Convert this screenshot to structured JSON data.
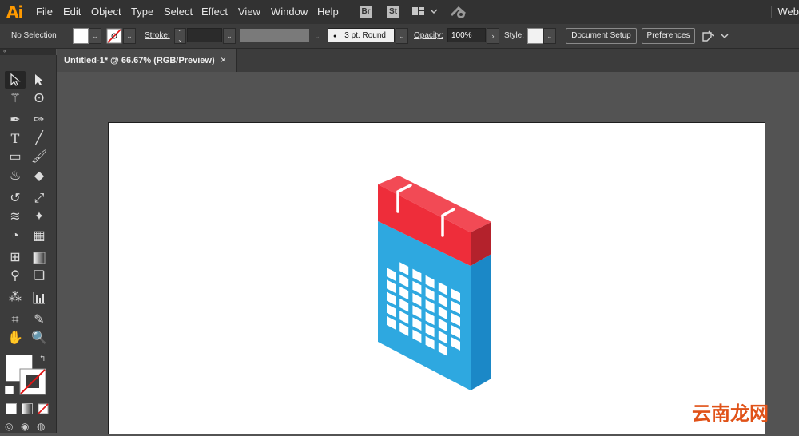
{
  "app": {
    "logo": "Ai",
    "menus": [
      "File",
      "Edit",
      "Object",
      "Type",
      "Select",
      "Effect",
      "View",
      "Window",
      "Help"
    ],
    "bridge_label": "Br",
    "stock_label": "St",
    "workspace": "Web"
  },
  "control": {
    "selection": "No Selection",
    "stroke_label": "Stroke:",
    "brush": "3 pt. Round",
    "opacity_label": "Opacity:",
    "opacity_value": "100%",
    "style_label": "Style:",
    "document_setup": "Document Setup",
    "preferences": "Preferences"
  },
  "panel_strip": "«",
  "document": {
    "tab_title": "Untitled-1* @ 66.67% (RGB/Preview)",
    "close": "×"
  },
  "watermark": "云南龙网",
  "colors": {
    "calendar_front": "#2EA8E0",
    "calendar_side": "#1B88C7",
    "header_front": "#EE2D3A",
    "header_top": "#F24A55",
    "header_side": "#B4222C",
    "brand_orange": "#FF9A00"
  },
  "icons": [
    "selection-tool-icon",
    "direct-selection-tool-icon",
    "magic-wand-icon",
    "lasso-icon",
    "pen-tool-icon",
    "curvature-tool-icon",
    "type-tool-icon",
    "line-tool-icon",
    "rectangle-tool-icon",
    "paintbrush-icon",
    "shaper-tool-icon",
    "eraser-icon",
    "rotate-tool-icon",
    "scale-tool-icon",
    "warp-tool-icon",
    "puppet-warp-icon",
    "shape-builder-icon",
    "perspective-grid-icon",
    "mesh-tool-icon",
    "gradient-tool-icon",
    "eyedropper-icon",
    "blend-tool-icon",
    "symbol-sprayer-icon",
    "column-graph-icon",
    "artboard-tool-icon",
    "slice-tool-icon",
    "hand-tool-icon",
    "zoom-tool-icon"
  ]
}
